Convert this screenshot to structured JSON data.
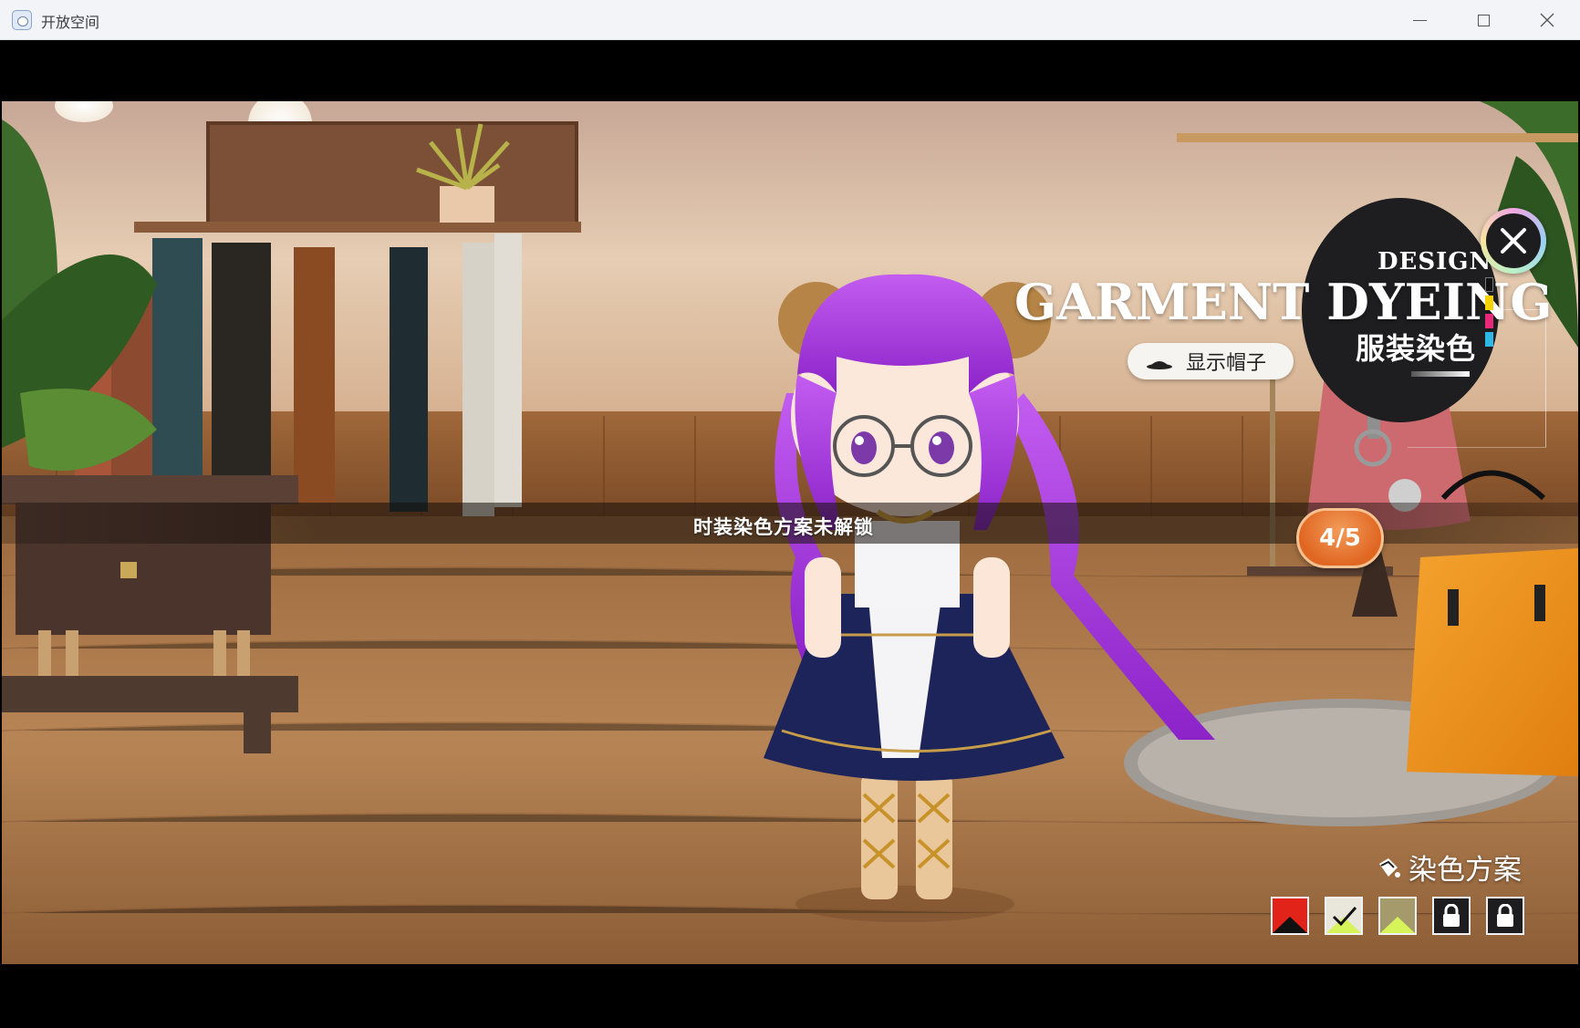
{
  "window": {
    "title": "开放空间",
    "controls": {
      "minimize": "minimize",
      "maximize": "maximize",
      "close": "close"
    }
  },
  "game": {
    "banner_text": "时装染色方案未解锁",
    "hat_toggle_label": "显示帽子",
    "badge": {
      "design": "DESIGN",
      "title": "GARMENT DYEING",
      "subtitle": "服装染色",
      "cmyk_colors": [
        "#111111",
        "#f6d200",
        "#e8297a",
        "#2fb8e6"
      ]
    },
    "counter": "4/5",
    "dye_schemes": {
      "label": "染色方案",
      "swatches": [
        {
          "state": "unlocked",
          "primary": "#e2231a",
          "secondary": "#111111",
          "selected": false
        },
        {
          "state": "unlocked",
          "primary": "#e9e6dc",
          "secondary": "#d6f35a",
          "selected": true
        },
        {
          "state": "unlocked",
          "primary": "#a59a6c",
          "secondary": "#d6f35a",
          "selected": false
        },
        {
          "state": "locked"
        },
        {
          "state": "locked"
        }
      ]
    }
  }
}
